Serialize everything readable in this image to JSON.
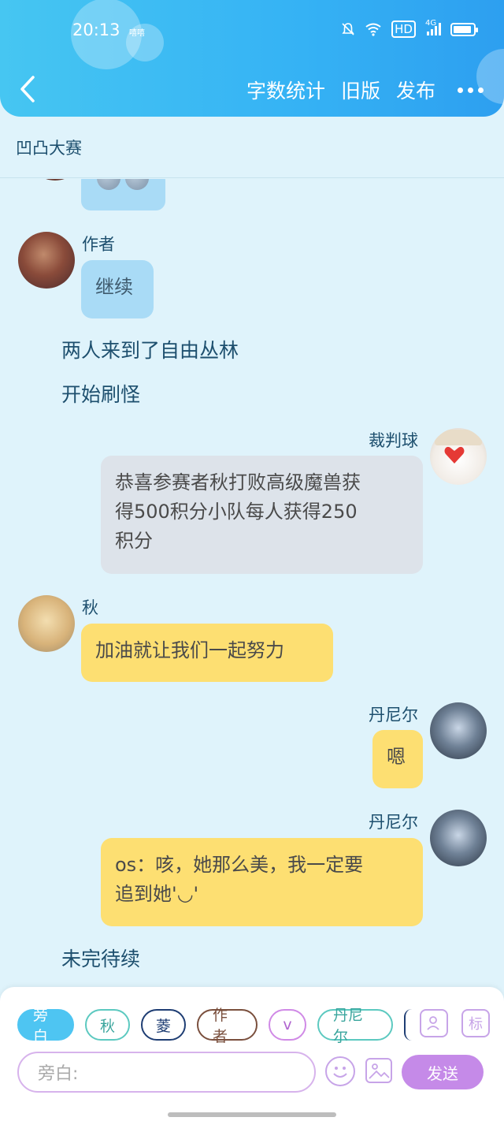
{
  "status_bar": {
    "time": "20:13",
    "carrier_label": "嘻嘻",
    "network": "4G",
    "hd": "HD"
  },
  "nav": {
    "actions": [
      "字数统计",
      "旧版",
      "发布"
    ]
  },
  "group": {
    "title": "凹凸大赛"
  },
  "messages": {
    "author_name": "作者",
    "author_text": "继续",
    "narration_1": "两人来到了自由丛林",
    "narration_2": "开始刷怪",
    "judge_name": "裁判球",
    "judge_text": "恭喜参赛者秋打败高级魔兽获得500积分小队每人获得250积分",
    "judge_line1": "恭喜参赛者秋打败高级魔兽获",
    "judge_line2": "得500积分小队每人获得250",
    "judge_line3": "积分",
    "qiu_name": "秋",
    "qiu_text": "加油就让我们一起努力",
    "dan_name_1": "丹尼尔",
    "dan_text_1": "嗯",
    "dan_name_2": "丹尼尔",
    "dan_line1": "os：咳，她那么美，我一定要",
    "dan_line2": "追到她'◡'",
    "narration_3": "未完待续"
  },
  "input_panel": {
    "roles": [
      "旁白",
      "秋",
      "菱",
      "作者",
      "v",
      "丹尼尔"
    ],
    "placeholder": "旁白:",
    "send_label": "发送",
    "tag_label": "标"
  }
}
